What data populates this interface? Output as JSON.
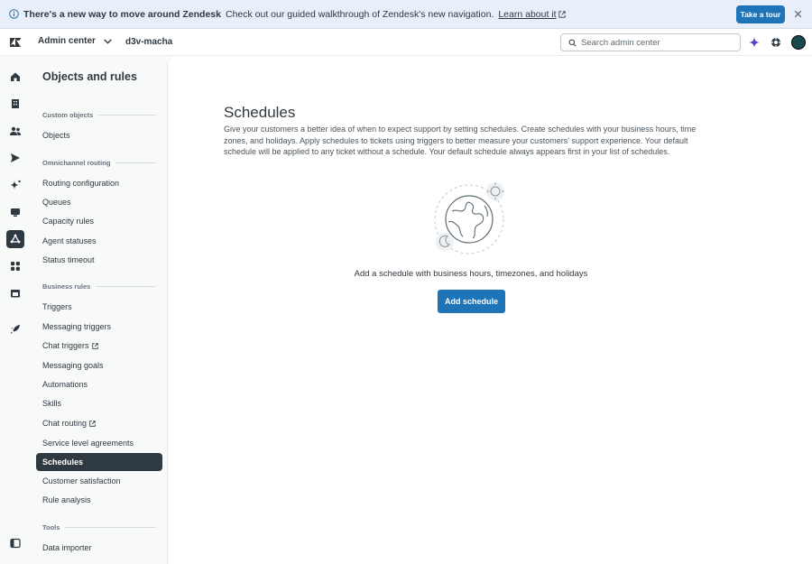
{
  "banner": {
    "title": "There's a new way to move around Zendesk",
    "text": "Check out our guided walkthrough of Zendesk's new navigation.",
    "link": "Learn about it",
    "tour_button": "Take a tour"
  },
  "header": {
    "product": "Admin center",
    "account": "d3v-macha",
    "search_placeholder": "Search admin center"
  },
  "sidenav": {
    "title": "Objects and rules",
    "sections": {
      "custom_objects": "Custom objects",
      "omnichannel": "Omnichannel routing",
      "business_rules": "Business rules",
      "tools": "Tools"
    },
    "items": {
      "objects": "Objects",
      "routing_configuration": "Routing configuration",
      "queues": "Queues",
      "capacity_rules": "Capacity rules",
      "agent_statuses": "Agent statuses",
      "status_timeout": "Status timeout",
      "triggers": "Triggers",
      "messaging_triggers": "Messaging triggers",
      "chat_triggers": "Chat triggers",
      "messaging_goals": "Messaging goals",
      "automations": "Automations",
      "skills": "Skills",
      "chat_routing": "Chat routing",
      "sla": "Service level agreements",
      "schedules": "Schedules",
      "customer_satisfaction": "Customer satisfaction",
      "rule_analysis": "Rule analysis",
      "data_importer": "Data importer"
    }
  },
  "main": {
    "title": "Schedules",
    "description": "Give your customers a better idea of when to expect support by setting schedules. Create schedules with your business hours, time zones, and holidays. Apply schedules to tickets using triggers to better measure your customers' support experience. Your default schedule will be applied to any ticket without a schedule. Your default schedule always appears first in your list of schedules.",
    "empty_text": "Add a schedule with business hours, timezones, and holidays",
    "add_button": "Add schedule"
  },
  "colors": {
    "accent": "#1f73b7",
    "banner_bg": "#e8effa",
    "active_nav": "#2f3941"
  }
}
